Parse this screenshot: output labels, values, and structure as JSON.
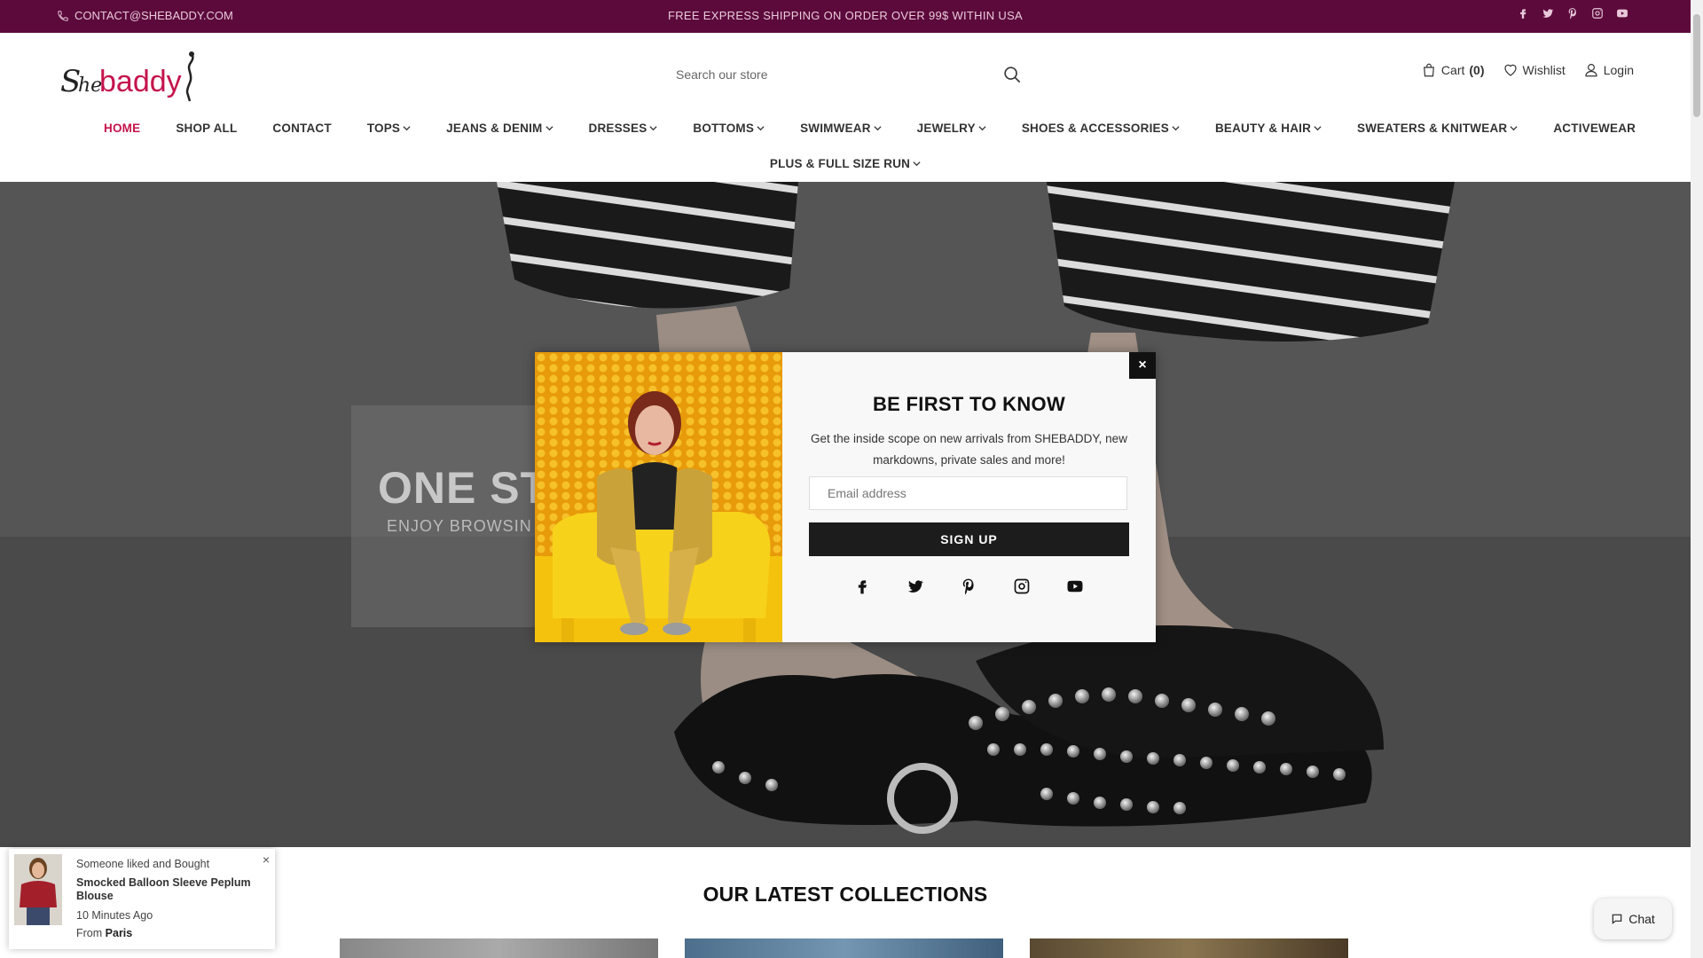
{
  "topbar": {
    "contact": "CONTACT@SHEBADDY.COM",
    "promo": "FREE EXPRESS SHIPPING ON ORDER OVER 99$ WITHIN USA",
    "social": [
      "facebook-icon",
      "twitter-icon",
      "pinterest-icon",
      "instagram-icon",
      "youtube-icon"
    ]
  },
  "header": {
    "logo_text": "Shebaddy",
    "search_placeholder": "Search our store",
    "cart_label": "Cart",
    "cart_count": "(0)",
    "wishlist_label": "Wishlist",
    "login_label": "Login"
  },
  "nav": {
    "items": [
      {
        "label": "HOME",
        "dropdown": false
      },
      {
        "label": "SHOP ALL",
        "dropdown": false
      },
      {
        "label": "CONTACT",
        "dropdown": false
      },
      {
        "label": "TOPS",
        "dropdown": true
      },
      {
        "label": "JEANS & DENIM",
        "dropdown": true
      },
      {
        "label": "DRESSES",
        "dropdown": true
      },
      {
        "label": "BOTTOMS",
        "dropdown": true
      },
      {
        "label": "SWIMWEAR",
        "dropdown": true
      },
      {
        "label": "JEWELRY",
        "dropdown": true
      },
      {
        "label": "SHOES & ACCESSORIES",
        "dropdown": true
      },
      {
        "label": "BEAUTY & HAIR",
        "dropdown": true
      },
      {
        "label": "SWEATERS & KNITWEAR",
        "dropdown": true
      },
      {
        "label": "ACTIVEWEAR",
        "dropdown": false
      }
    ],
    "row2": {
      "label": "PLUS & FULL SIZE RUN",
      "dropdown": true
    }
  },
  "hero": {
    "title_visible": "ONE ST",
    "subtitle_visible": "ENJOY BROWSIN"
  },
  "popup": {
    "title": "BE FIRST TO KNOW",
    "description": "Get the inside scope on new arrivals from SHEBADDY, new markdowns, private sales and more!",
    "email_placeholder": "Email address",
    "signup_label": "SIGN UP",
    "close_label": "×",
    "social": [
      "facebook-icon",
      "twitter-icon",
      "pinterest-icon",
      "instagram-icon",
      "youtube-icon"
    ]
  },
  "collections": {
    "title": "OUR LATEST COLLECTIONS"
  },
  "notification": {
    "line1": "Someone liked and Bought",
    "product": "Smocked Balloon Sleeve Peplum Blouse",
    "time": "10 Minutes Ago",
    "from_label": "From",
    "city": "Paris",
    "close_label": "×"
  },
  "chat": {
    "label": "Chat"
  },
  "colors": {
    "topbar_bg": "#5c0a3b",
    "active_nav": "#c4154d",
    "button_dark": "#1c1c1c"
  }
}
